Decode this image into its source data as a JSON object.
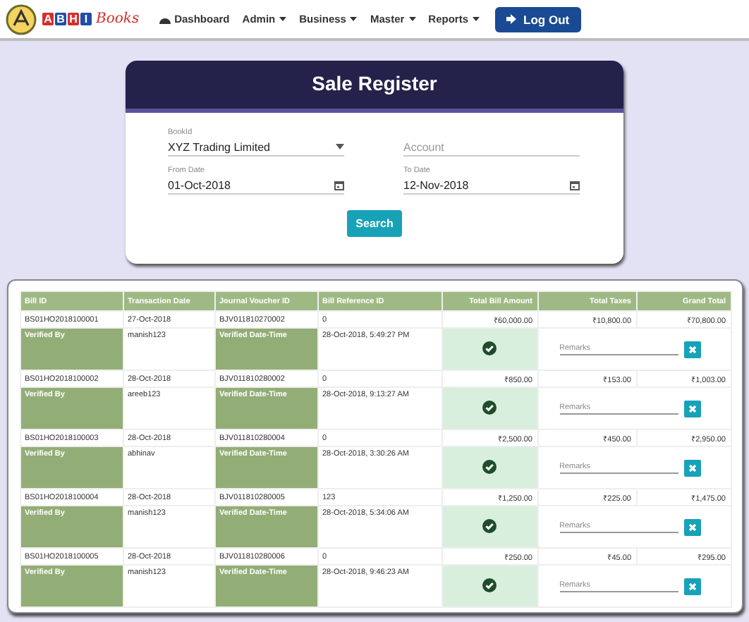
{
  "navbar": {
    "brand_letters": [
      "A",
      "B",
      "H",
      "I"
    ],
    "brand_script": "Books",
    "items": [
      {
        "label": "Dashboard",
        "kind": "link"
      },
      {
        "label": "Admin",
        "kind": "dropdown"
      },
      {
        "label": "Business",
        "kind": "dropdown"
      },
      {
        "label": "Master",
        "kind": "dropdown"
      },
      {
        "label": "Reports",
        "kind": "dropdown"
      }
    ],
    "logout": "Log Out"
  },
  "form": {
    "title": "Sale Register",
    "fields": [
      {
        "label": "BookId",
        "value": "XYZ Trading Limited",
        "kind": "select"
      },
      {
        "placeholder": "Account",
        "kind": "text"
      },
      {
        "label": "From Date",
        "value": "01-Oct-2018",
        "kind": "date"
      },
      {
        "label": "To Date",
        "value": "12-Nov-2018",
        "kind": "date"
      }
    ],
    "search_button": "Search"
  },
  "table": {
    "columns": [
      "Bill ID",
      "Transaction Date",
      "Journal Voucher ID",
      "Bill Reference ID",
      "Total Bill Amount",
      "Total Taxes",
      "Grand Total"
    ],
    "rows": [
      {
        "bill_id": "BS01HO2018100001",
        "transaction_date": "27-Oct-2018",
        "journal_voucher_id": "BJV011810270002",
        "bill_reference_id": "0",
        "total_bill_amount": "₹60,000.00",
        "total_taxes": "₹10,800.00",
        "grand_total": "₹70,800.00",
        "verified_by_label": "Verified By",
        "verified_by": "manish123",
        "verified_datetime_label": "Verified Date-Time",
        "verified_datetime": "28-Oct-2018, 5:49:27 PM",
        "verified": true,
        "remarks_placeholder": "Remarks"
      },
      {
        "bill_id": "BS01HO2018100002",
        "transaction_date": "28-Oct-2018",
        "journal_voucher_id": "BJV011810280002",
        "bill_reference_id": "0",
        "total_bill_amount": "₹850.00",
        "total_taxes": "₹153.00",
        "grand_total": "₹1,003.00",
        "verified_by_label": "Verified By",
        "verified_by": "areeb123",
        "verified_datetime_label": "Verified Date-Time",
        "verified_datetime": "28-Oct-2018, 9:13:27 AM",
        "verified": true,
        "remarks_placeholder": "Remarks"
      },
      {
        "bill_id": "BS01HO2018100003",
        "transaction_date": "28-Oct-2018",
        "journal_voucher_id": "BJV011810280004",
        "bill_reference_id": "0",
        "total_bill_amount": "₹2,500.00",
        "total_taxes": "₹450.00",
        "grand_total": "₹2,950.00",
        "verified_by_label": "Verified By",
        "verified_by": "abhinav",
        "verified_datetime_label": "Verified Date-Time",
        "verified_datetime": "28-Oct-2018, 3:30:26 AM",
        "verified": true,
        "remarks_placeholder": "Remarks"
      },
      {
        "bill_id": "BS01HO2018100004",
        "transaction_date": "28-Oct-2018",
        "journal_voucher_id": "BJV011810280005",
        "bill_reference_id": "123",
        "total_bill_amount": "₹1,250.00",
        "total_taxes": "₹225.00",
        "grand_total": "₹1,475.00",
        "verified_by_label": "Verified By",
        "verified_by": "manish123",
        "verified_datetime_label": "Verified Date-Time",
        "verified_datetime": "28-Oct-2018, 5:34:06 AM",
        "verified": true,
        "remarks_placeholder": "Remarks"
      },
      {
        "bill_id": "BS01HO2018100005",
        "transaction_date": "28-Oct-2018",
        "journal_voucher_id": "BJV011810280006",
        "bill_reference_id": "0",
        "total_bill_amount": "₹250.00",
        "total_taxes": "₹45.00",
        "grand_total": "₹295.00",
        "verified_by_label": "Verified By",
        "verified_by": "manish123",
        "verified_datetime_label": "Verified Date-Time",
        "verified_datetime": "28-Oct-2018, 9:46:23 AM",
        "verified": true,
        "remarks_placeholder": "Remarks"
      }
    ]
  }
}
